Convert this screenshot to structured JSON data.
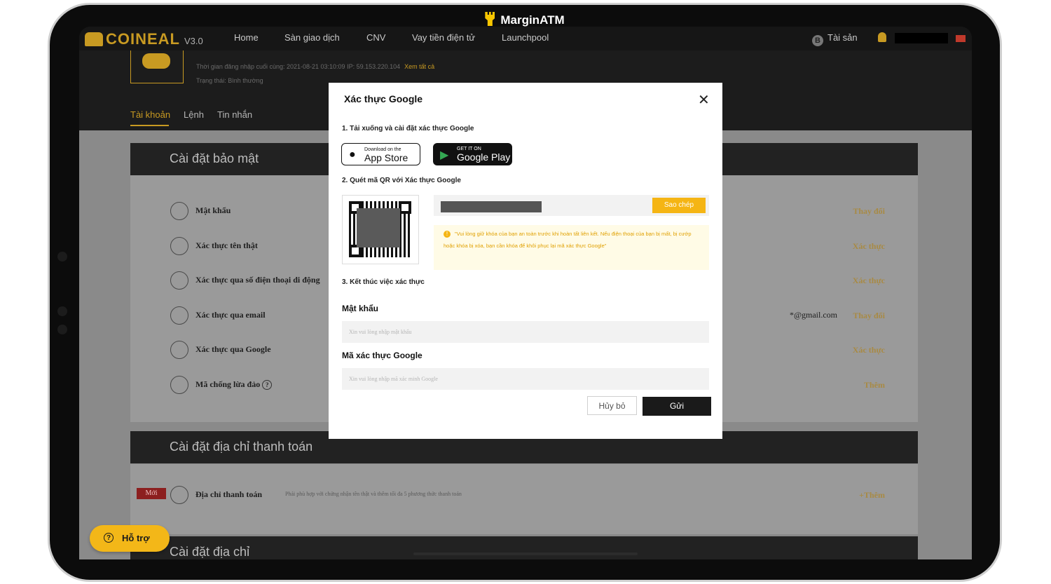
{
  "brand": {
    "name": "MarginATM"
  },
  "nav": {
    "logo": "COINEAL",
    "version": "V3.0",
    "items": [
      "Home",
      "Sàn giao dịch",
      "CNV",
      "Vay tiền điện tử",
      "Launchpool"
    ],
    "assets_label": "Tài sản",
    "coin_symbol": "B"
  },
  "profile": {
    "login_info": "Thời gian đăng nhập cuối cùng: 2021-08-21 03:10:09  IP: 59.153.220.104",
    "view_all": "Xem tất cả",
    "status": "Trạng thái: Bình thường"
  },
  "tabs": [
    "Tài khoản",
    "Lệnh",
    "Tin nhắn"
  ],
  "security": {
    "title": "Cài đặt bảo mật",
    "rows": [
      {
        "label": "Mật khẩu",
        "action": "Thay đổi",
        "value": ""
      },
      {
        "label": "Xác thực tên thật",
        "action": "Xác thực",
        "value": ""
      },
      {
        "label": "Xác thực qua số điện thoại di động",
        "action": "Xác thực",
        "value": ""
      },
      {
        "label": "Xác thực qua email",
        "action": "Thay đổi",
        "value": "*@gmail.com"
      },
      {
        "label": "Xác thực qua Google",
        "action": "Xác thực",
        "value": ""
      },
      {
        "label": "Mã chống lừa đảo",
        "action": "Thêm",
        "value": ""
      }
    ]
  },
  "payment": {
    "title": "Cài đặt địa chỉ thanh toán",
    "badge": "Mới",
    "label": "Địa chỉ thanh toán",
    "note": "Phải phù hợp với chứng nhận tên thật và thêm tối đa 5 phương thức thanh toán",
    "action": "+Thêm"
  },
  "address": {
    "title": "Cài đặt địa chỉ"
  },
  "support": {
    "label": "Hỗ trợ"
  },
  "modal": {
    "title": "Xác thực Google",
    "step1": "1. Tải xuống và cài đặt xác thực Google",
    "appstore_small": "Download on the",
    "appstore_big": "App Store",
    "googleplay_small": "GET IT ON",
    "googleplay_big": "Google Play",
    "step2": "2. Quét mã QR với Xác thực Google",
    "copy_label": "Sao chép",
    "warning": "\"Vui lòng giữ khóa của bạn an toàn trước khi hoàn tất liên kết. Nếu điện thoại của bạn bị mất, bị cướp hoặc khóa bị xóa, bạn cần khóa để khôi phục lại mã xác thực Google\"",
    "step3": "3. Kết thúc việc xác thực",
    "password_label": "Mật khẩu",
    "password_placeholder": "Xin vui lòng nhập mật khẩu",
    "code_label": "Mã xác thực Google",
    "code_placeholder": "Xin vui lòng nhập mã xác minh Google",
    "cancel": "Hủy bỏ",
    "submit": "Gửi"
  }
}
